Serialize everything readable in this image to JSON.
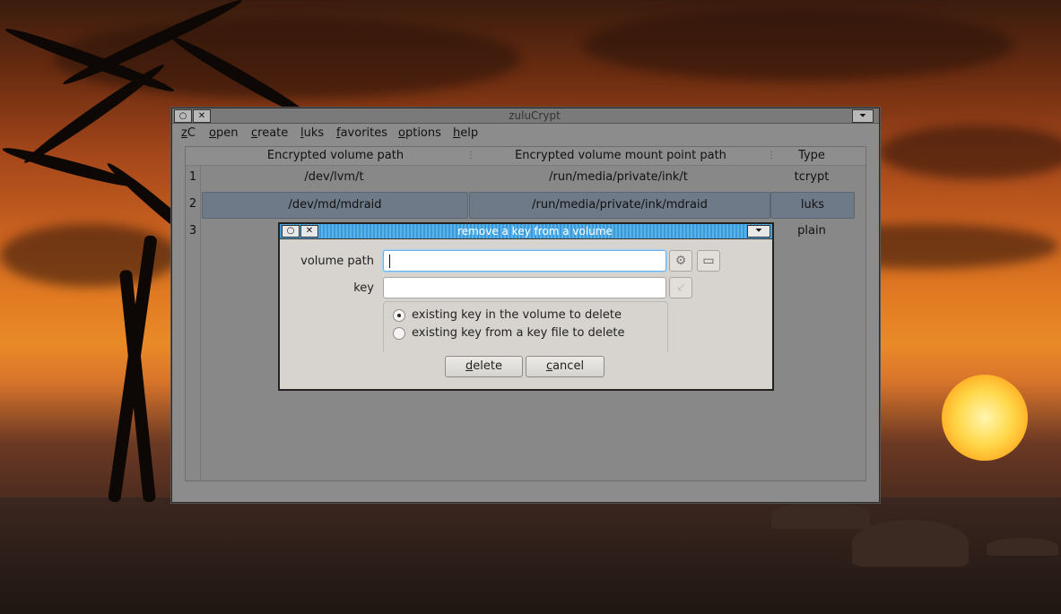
{
  "main_window": {
    "title": "zuluCrypt",
    "menu": [
      {
        "label": "zC",
        "mnemonic": "z"
      },
      {
        "label": "open",
        "mnemonic": "o"
      },
      {
        "label": "create",
        "mnemonic": "c"
      },
      {
        "label": "luks",
        "mnemonic": "l"
      },
      {
        "label": "favorites",
        "mnemonic": "f"
      },
      {
        "label": "options",
        "mnemonic": "o"
      },
      {
        "label": "help",
        "mnemonic": "h"
      }
    ],
    "table": {
      "columns": [
        "Encrypted volume path",
        "Encrypted volume mount point path",
        "Type"
      ],
      "rows": [
        {
          "num": "1",
          "path": "/dev/lvm/t",
          "mount": "/run/media/private/ink/t",
          "type": "tcrypt"
        },
        {
          "num": "2",
          "path": "/dev/md/mdraid",
          "mount": "/run/media/private/ink/mdraid",
          "type": "luks",
          "selected": true
        },
        {
          "num": "3",
          "path": "",
          "mount": "",
          "type": "plain"
        }
      ]
    }
  },
  "dialog": {
    "title": "remove a key from a volume",
    "volume_path_label": "volume path",
    "volume_path_value": "",
    "key_label": "key",
    "key_value": "",
    "options": [
      {
        "label": "existing key in the volume to delete",
        "checked": true
      },
      {
        "label": "existing key from a key file to delete",
        "checked": false
      }
    ],
    "delete_label": "delete",
    "cancel_label": "cancel",
    "icons": {
      "volume_browse": "gear-icon",
      "volume_device": "drive-icon",
      "key_option": "key-file-icon"
    }
  }
}
